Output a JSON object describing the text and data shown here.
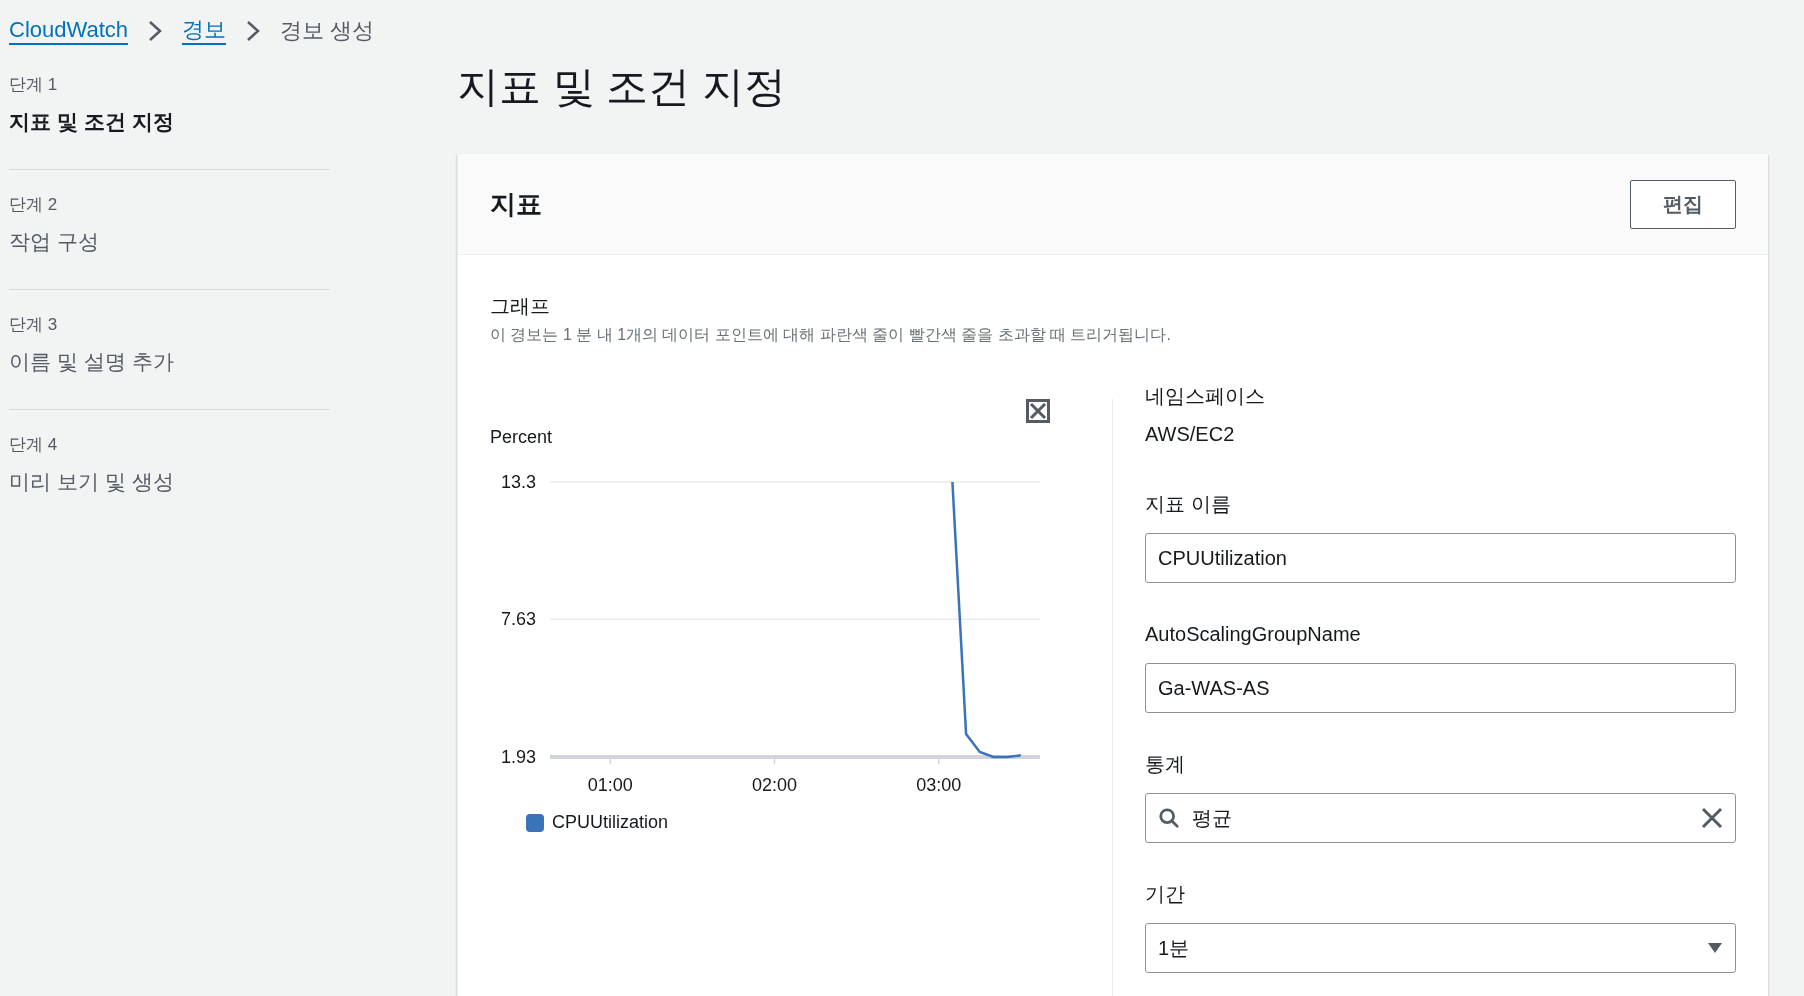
{
  "breadcrumb": [
    {
      "label": "CloudWatch",
      "link": true
    },
    {
      "label": "경보",
      "link": true
    },
    {
      "label": "경보 생성",
      "link": false
    }
  ],
  "steps": [
    {
      "step": "단계 1",
      "title": "지표 및 조건 지정",
      "selected": true
    },
    {
      "step": "단계 2",
      "title": "작업 구성",
      "selected": false
    },
    {
      "step": "단계 3",
      "title": "이름 및 설명 추가",
      "selected": false
    },
    {
      "step": "단계 4",
      "title": "미리 보기 및 생성",
      "selected": false
    }
  ],
  "page_title": "지표 및 조건 지정",
  "panel": {
    "title": "지표",
    "edit_button": "편집",
    "graph": {
      "label": "그래프",
      "description": "이 경보는 1 분 내 1개의 데이터 포인트에 대해 파란색 줄이 빨간색 줄을 초과할 때 트리거됩니다.",
      "chart_data": {
        "type": "line",
        "ylabel": "Percent",
        "x": [
          185,
          190,
          195,
          200,
          205,
          210
        ],
        "series": [
          {
            "name": "CPUUtilization",
            "color": "#3b73b9",
            "values": [
              13.3,
              2.88,
              2.14,
              1.93,
              1.93,
              2.0
            ]
          }
        ],
        "xlim": [
          38,
          217
        ],
        "ylim": [
          1.93,
          13.3
        ],
        "xticks": [
          {
            "value": 60,
            "label": "01:00"
          },
          {
            "value": 120,
            "label": "02:00"
          },
          {
            "value": 180,
            "label": "03:00"
          }
        ],
        "yticks": [
          {
            "value": 1.93,
            "label": "1.93"
          },
          {
            "value": 7.63,
            "label": "7.63"
          },
          {
            "value": 13.3,
            "label": "13.3"
          }
        ]
      }
    },
    "fields": [
      {
        "kind": "text",
        "label": "네임스페이스",
        "value": "AWS/EC2"
      },
      {
        "kind": "input",
        "label": "지표 이름",
        "value": "CPUUtilization"
      },
      {
        "kind": "input",
        "label": "AutoScalingGroupName",
        "value": "Ga-WAS-AS"
      },
      {
        "kind": "search",
        "label": "통계",
        "value": "평균"
      },
      {
        "kind": "select",
        "label": "기간",
        "value": "1분"
      }
    ]
  }
}
